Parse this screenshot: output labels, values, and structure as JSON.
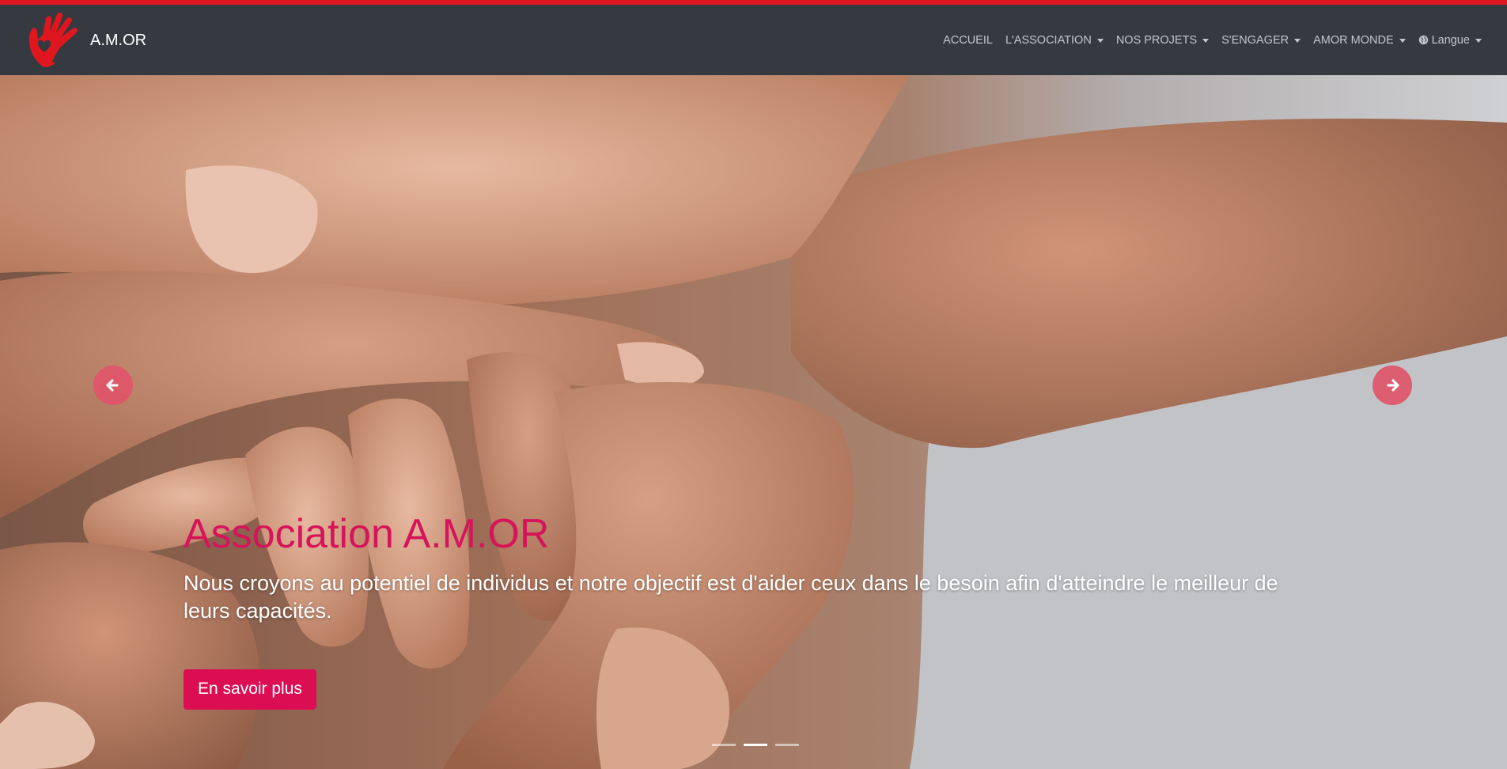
{
  "brand": {
    "name": "A.M.OR",
    "logo_icon": "hand-heart-icon",
    "accent_color": "#e0161e"
  },
  "nav": {
    "items": [
      {
        "label": "ACCUEIL",
        "dropdown": false
      },
      {
        "label": "L'ASSOCIATION",
        "dropdown": true
      },
      {
        "label": "NOS PROJETS",
        "dropdown": true
      },
      {
        "label": "S'ENGAGER",
        "dropdown": true
      },
      {
        "label": "AMOR MONDE",
        "dropdown": true
      },
      {
        "label": "Langue",
        "dropdown": true,
        "icon": "globe-icon"
      }
    ]
  },
  "carousel": {
    "title": "Association A.M.OR",
    "text": "Nous croyons au potentiel de individus et notre objectif est d'aider ceux dans le besoin afin d'atteindre le meilleur de leurs capacités.",
    "button_label": "En savoir plus",
    "prev_icon": "arrow-left-circle-icon",
    "next_icon": "arrow-right-circle-icon",
    "slide_count": 3,
    "active_slide": 2,
    "title_color": "#d6145a",
    "button_color": "#dc0e53"
  }
}
